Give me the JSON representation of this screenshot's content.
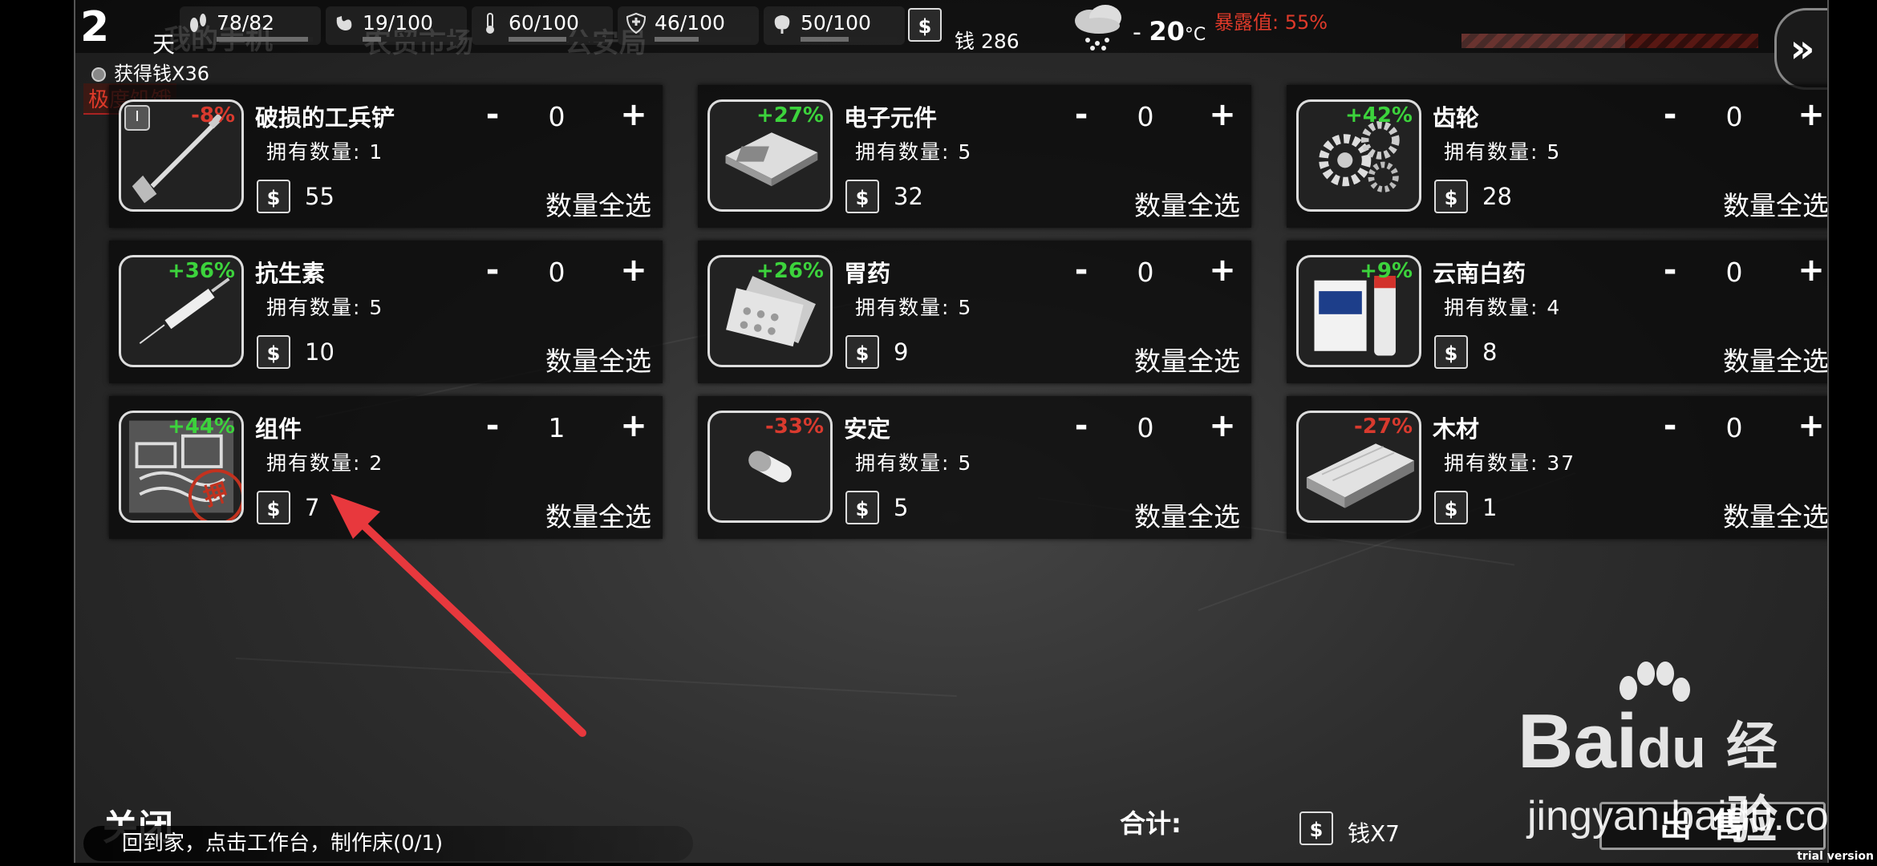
{
  "status": {
    "day_number": "2",
    "day_label": "天",
    "ghost_tabs": [
      "我的手机",
      "农贸市场",
      "公安局"
    ],
    "stats": [
      {
        "icon": "footprint-icon",
        "value": "78/82",
        "level": 0.95
      },
      {
        "icon": "stomach-icon",
        "value": "19/100",
        "level": 0.19
      },
      {
        "icon": "thermometer-icon",
        "value": "60/100",
        "level": 0.6
      },
      {
        "icon": "shield-heart-icon",
        "value": "46/100",
        "level": 0.46
      },
      {
        "icon": "brain-icon",
        "value": "50/100",
        "level": 0.5
      }
    ],
    "money_label": "钱 286",
    "temperature": {
      "prefix": "-",
      "value": "20",
      "unit": "°C"
    },
    "exposure_label": "暴露值: 55%",
    "exposure_level": 0.55,
    "fast_forward": "»"
  },
  "notification": "获得钱X36",
  "hunger_status": "极度饥饿",
  "items": [
    {
      "name": "破损的工兵铲",
      "pct": "-8%",
      "trend": "down",
      "owned": "拥有数量: 1",
      "price": "55",
      "qty": "0",
      "icon": "shovel-icon",
      "badge": "I"
    },
    {
      "name": "电子元件",
      "pct": "+27%",
      "trend": "up",
      "owned": "拥有数量: 5",
      "price": "32",
      "qty": "0",
      "icon": "circuit-board-icon"
    },
    {
      "name": "齿轮",
      "pct": "+42%",
      "trend": "up",
      "owned": "拥有数量: 5",
      "price": "28",
      "qty": "0",
      "icon": "gears-icon"
    },
    {
      "name": "抗生素",
      "pct": "+36%",
      "trend": "up",
      "owned": "拥有数量: 5",
      "price": "10",
      "qty": "0",
      "icon": "syringe-icon"
    },
    {
      "name": "胃药",
      "pct": "+26%",
      "trend": "up",
      "owned": "拥有数量: 5",
      "price": "9",
      "qty": "0",
      "icon": "pill-blister-icon"
    },
    {
      "name": "云南白药",
      "pct": "+9%",
      "trend": "up",
      "owned": "拥有数量: 4",
      "price": "8",
      "qty": "0",
      "icon": "medicine-box-icon"
    },
    {
      "name": "组件",
      "pct": "+44%",
      "trend": "up",
      "owned": "拥有数量: 2",
      "price": "7",
      "qty": "1",
      "icon": "components-icon",
      "stamp": "押"
    },
    {
      "name": "安定",
      "pct": "-33%",
      "trend": "down",
      "owned": "拥有数量: 5",
      "price": "5",
      "qty": "0",
      "icon": "capsule-icon"
    },
    {
      "name": "木材",
      "pct": "-27%",
      "trend": "down",
      "owned": "拥有数量: 37",
      "price": "1",
      "qty": "0",
      "icon": "wood-planks-icon"
    }
  ],
  "controls": {
    "minus": "-",
    "plus": "+",
    "select_all": "数量全选",
    "money_symbol": "$"
  },
  "footer": {
    "close": "关闭",
    "quest": "回到家，点击工作台，制作床(0/1)",
    "total_label": "合计:",
    "total_value": "钱X7",
    "sell": "出售"
  },
  "watermark": {
    "brand_latin": "Bai",
    "brand_du": "du",
    "brand_cn": "经验",
    "url": "jingyan.baidu.com"
  },
  "trial": "trial version",
  "colors": {
    "up": "#3cd33c",
    "down": "#d93a2e",
    "exposure": "#e03a2a",
    "arrow": "#e8383d"
  }
}
